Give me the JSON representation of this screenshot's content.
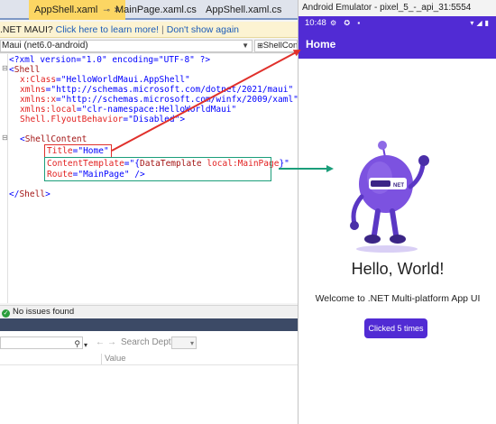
{
  "vs": {
    "tabs": [
      {
        "label": "AppShell.xaml",
        "pin_icon": "pin-icon",
        "close_icon": "close-icon",
        "active": true
      },
      {
        "label": "MainPage.xaml.cs",
        "active": false
      },
      {
        "label": "AppShell.xaml.cs",
        "active": false
      }
    ],
    "infobar": {
      "text": ".NET MAUI? ",
      "learn_more": "Click here to learn more!",
      "separator": "|",
      "dont_show": "Don't show again"
    },
    "navbar": {
      "framework": "Maui (net6.0-android)",
      "member": "ShellCont"
    },
    "code": {
      "line1": {
        "decl": "<?xml version=\"1.0\" encoding=\"UTF-8\" ?>"
      },
      "line2": {
        "open": "<",
        "tag": "Shell"
      },
      "line3": {
        "attr": "x:Class",
        "eq": "=",
        "val": "\"HelloWorldMaui.AppShell\""
      },
      "line4": {
        "attr": "xmlns",
        "eq": "=",
        "val": "\"http://schemas.microsoft.com/dotnet/2021/maui\""
      },
      "line5": {
        "attr": "xmlns:x",
        "eq": "=",
        "val": "\"http://schemas.microsoft.com/winfx/2009/xaml\""
      },
      "line6": {
        "attr": "xmlns:local",
        "eq": "=",
        "val": "\"clr-namespace:HelloWorldMaui\""
      },
      "line7": {
        "attr": "Shell.FlyoutBehavior",
        "eq": "=",
        "val": "\"Disabled\"",
        "close": ">"
      },
      "line9": {
        "open": "<",
        "tag": "ShellContent"
      },
      "line10": {
        "attr": "Title",
        "eq": "=",
        "val": "\"Home\""
      },
      "line11": {
        "attr": "ContentTemplate",
        "eq": "=",
        "val_open": "\"{",
        "ext": "DataTemplate",
        "ext_arg": "local:MainPage",
        "val_close": "}\""
      },
      "line12": {
        "attr": "Route",
        "eq": "=",
        "val": "\"MainPage\"",
        "close": " />"
      },
      "line14": {
        "close_tag": "</",
        "tag": "Shell",
        "end": ">"
      }
    },
    "status": {
      "text": "No issues found"
    },
    "toolwindow": {
      "search_depth_label": "Search Depth:",
      "value_column": "Value",
      "back_icon": "←",
      "forward_icon": "→"
    }
  },
  "emulator": {
    "window_title": "Android Emulator - pixel_5_-_api_31:5554",
    "time": "10:48",
    "status_icons": "⚙ ✪ ▪",
    "right_icons": "▾◢▮",
    "appbar_title": "Home",
    "hello": "Hello, World!",
    "welcome": "Welcome to .NET Multi-platform App UI",
    "button_label": "Clicked 5 times",
    "bot_badge": "NET"
  },
  "colors": {
    "maui_purple": "#512bd4",
    "highlight_red": "#e0302b",
    "highlight_green": "#1b9e7a",
    "tab_active": "#fcd663"
  }
}
